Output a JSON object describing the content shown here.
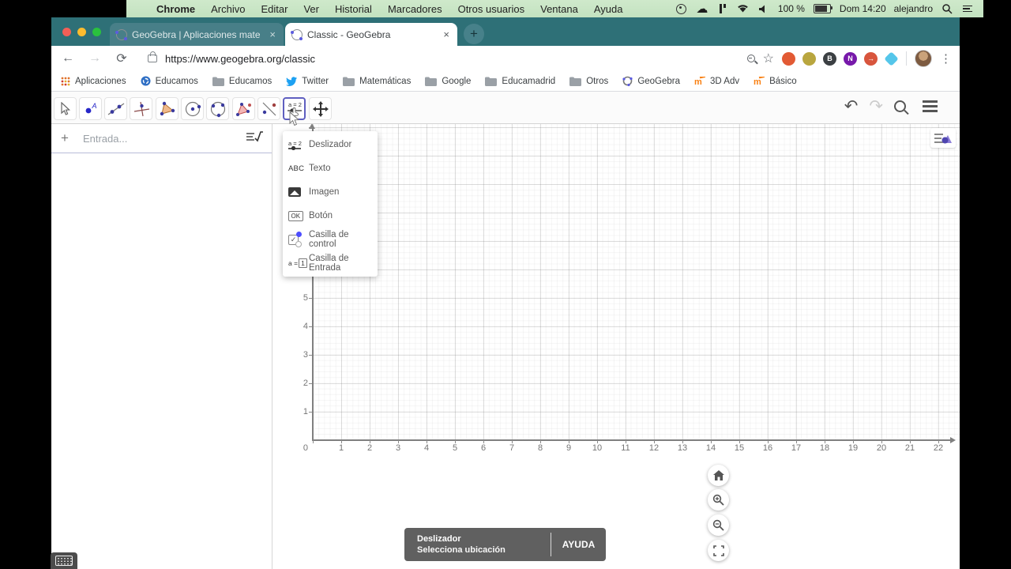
{
  "menubar": {
    "apple": "",
    "items": [
      "Chrome",
      "Archivo",
      "Editar",
      "Ver",
      "Historial",
      "Marcadores",
      "Otros usuarios",
      "Ventana",
      "Ayuda"
    ],
    "battery_pct": "100 %",
    "clock": "Dom 14:20",
    "user": "alejandro"
  },
  "browser": {
    "tabs": [
      {
        "title": "GeoGebra | Aplicaciones mate",
        "close": "×"
      },
      {
        "title": "Classic - GeoGebra",
        "close": "×"
      }
    ],
    "new_tab": "+",
    "url": "https://www.geogebra.org/classic",
    "bookmarks": [
      {
        "icon": "apps-icon",
        "label": "Aplicaciones"
      },
      {
        "icon": "globe-icon",
        "label": "Educamos"
      },
      {
        "icon": "folder-icon",
        "label": "Educamos"
      },
      {
        "icon": "twitter-icon",
        "label": "Twitter"
      },
      {
        "icon": "folder-icon",
        "label": "Matemáticas"
      },
      {
        "icon": "folder-icon",
        "label": "Google"
      },
      {
        "icon": "folder-icon",
        "label": "Educamadrid"
      },
      {
        "icon": "folder-icon",
        "label": "Otros"
      },
      {
        "icon": "geogebra-icon",
        "label": "GeoGebra"
      },
      {
        "icon": "moodle-icon",
        "label": "3D Adv"
      },
      {
        "icon": "moodle-icon",
        "label": "Básico"
      }
    ],
    "extensions": [
      {
        "name": "duckduckgo-icon",
        "bg": "#e25a34",
        "glyph": ""
      },
      {
        "name": "shield-ext-icon",
        "bg": "#b9a63f",
        "glyph": ""
      },
      {
        "name": "b-ext-icon",
        "bg": "#3c4043",
        "glyph": "B"
      },
      {
        "name": "onenote-icon",
        "bg": "#7719aa",
        "glyph": "N"
      },
      {
        "name": "arrow-ext-icon",
        "bg": "#d8553d",
        "glyph": "→"
      },
      {
        "name": "diamond-ext-icon",
        "bg": "#55c6ea",
        "glyph": "",
        "shape": "diamond"
      }
    ]
  },
  "geogebra": {
    "input_placeholder": "Entrada...",
    "dropdown": [
      {
        "icon": "slider-icon",
        "label": "Deslizador"
      },
      {
        "icon": "text-icon",
        "label": "Texto"
      },
      {
        "icon": "image-icon",
        "label": "Imagen"
      },
      {
        "icon": "button-icon",
        "label": "Botón"
      },
      {
        "icon": "checkbox-icon",
        "label": "Casilla de control"
      },
      {
        "icon": "inputbox-icon",
        "label": "Casilla de Entrada"
      }
    ],
    "icon_glyphs": {
      "slider": "a = 2",
      "text": "ABC",
      "button": "OK",
      "input_prefix": "a =",
      "input_box": "1"
    },
    "tooltip": {
      "title": "Deslizador",
      "subtitle": "Selecciona ubicación",
      "help": "AYUDA"
    },
    "axes": {
      "x_labels": [
        0,
        1,
        2,
        3,
        4,
        5,
        6,
        7,
        8,
        9,
        10,
        11,
        12,
        13,
        14,
        15,
        16,
        17,
        18,
        19,
        20,
        21,
        22
      ],
      "y_labels": [
        1,
        2,
        3,
        4,
        5
      ]
    }
  }
}
